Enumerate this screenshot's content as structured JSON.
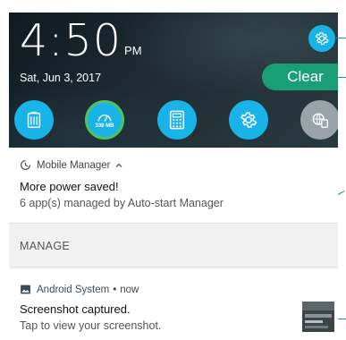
{
  "status": {
    "time": "4:50",
    "ampm": "PM",
    "date": "Sat, Jun 3, 2017"
  },
  "header": {
    "clear_label": "Clear",
    "settings_icon": "gear-icon"
  },
  "quick_settings": [
    {
      "name": "qs-power-saver",
      "icon": "battery-saver-icon",
      "state": "active"
    },
    {
      "name": "qs-boost",
      "icon": "speedometer-icon",
      "label": "339 MB",
      "state": "active"
    },
    {
      "name": "qs-calculator",
      "icon": "calculator-icon",
      "state": "active"
    },
    {
      "name": "qs-settings",
      "icon": "gear-icon",
      "state": "active"
    },
    {
      "name": "qs-screen-cast",
      "icon": "cast-icon",
      "state": "inactive"
    }
  ],
  "notifications": [
    {
      "app": "Mobile Manager",
      "title": "More power saved!",
      "body": "6 app(s) managed by Auto-start Manager",
      "action": "MANAGE"
    },
    {
      "app": "Android System",
      "time": "now",
      "title": "Screenshot captured.",
      "body": "Tap to view your screenshot."
    }
  ],
  "colors": {
    "accent_blue": "#19b3e8",
    "clear_green": "#1a9e74",
    "inactive_gray": "#9aa3a7",
    "pointer_blue": "#1e88c5"
  }
}
